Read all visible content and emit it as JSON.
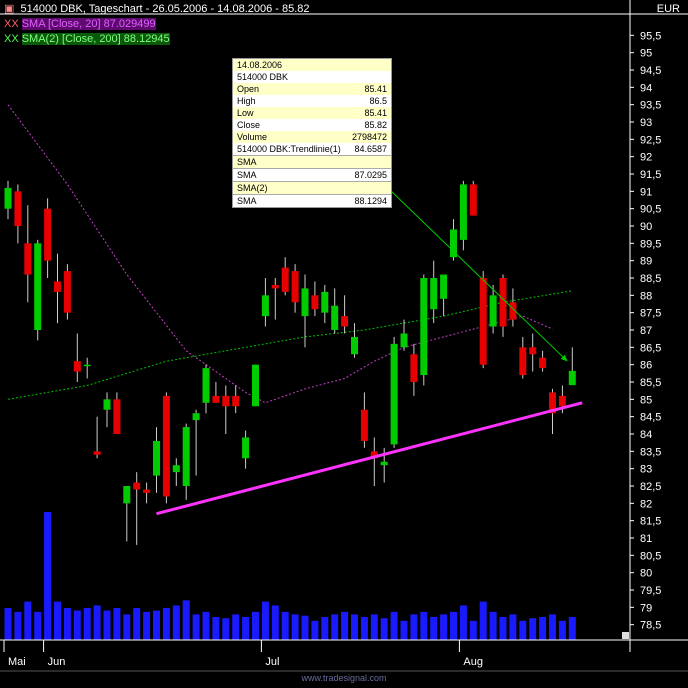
{
  "header": {
    "title": "514000  DBK, Tageschart - 26.05.2006 - 14.08.2006 - 85.82",
    "currency": "EUR",
    "legend": [
      {
        "marker": "XX",
        "text": "SMA [Close, 20] 87.029499",
        "color": "#e060ff"
      },
      {
        "marker": "XX",
        "text": "SMA(2) [Close, 200] 88.12945",
        "color": "#4fff4f"
      }
    ]
  },
  "infobox": {
    "date": "14.08.2006",
    "symbol": "514000  DBK",
    "rows": [
      {
        "label": "Open",
        "value": "85.41"
      },
      {
        "label": "High",
        "value": "86.5"
      },
      {
        "label": "Low",
        "value": "85.41"
      },
      {
        "label": "Close",
        "value": "85.82"
      },
      {
        "label": "Volume",
        "value": "2798472"
      },
      {
        "label": "514000  DBK:Trendlinie(1)",
        "value": "84.6587"
      },
      {
        "label": "SMA",
        "value": ""
      },
      {
        "label": "SMA",
        "value": "87.0295"
      },
      {
        "label": "SMA(2)",
        "value": ""
      },
      {
        "label": "SMA",
        "value": "88.1294"
      }
    ]
  },
  "footer": "www.tradesignal.com",
  "colors": {
    "up": "#00cc00",
    "down": "#e60000",
    "volume": "#1a1aff",
    "sma20": "#c040c0",
    "sma200": "#00c000",
    "trendline": "#ff33ff",
    "arrow": "#00cc00",
    "background": "#000000",
    "axis": "#ffffff"
  },
  "chart_data": {
    "type": "candlestick",
    "ylim": [
      78,
      96
    ],
    "yticks": [
      "78,5",
      "79",
      "79,5",
      "80",
      "80,5",
      "81",
      "81,5",
      "82",
      "82,5",
      "83",
      "83,5",
      "84",
      "84,5",
      "85",
      "85,5",
      "86",
      "86,5",
      "87",
      "87,5",
      "88",
      "88,5",
      "89",
      "89,5",
      "90",
      "90,5",
      "91",
      "91,5",
      "92",
      "92,5",
      "93",
      "93,5",
      "94",
      "94,5",
      "95",
      "95,5"
    ],
    "ytick_values": [
      78.5,
      79,
      79.5,
      80,
      80.5,
      81,
      81.5,
      82,
      82.5,
      83,
      83.5,
      84,
      84.5,
      85,
      85.5,
      86,
      86.5,
      87,
      87.5,
      88,
      88.5,
      89,
      89.5,
      90,
      90.5,
      91,
      91.5,
      92,
      92.5,
      93,
      93.5,
      94,
      94.5,
      95,
      95.5
    ],
    "xticks": [
      {
        "label": "Mai",
        "index": 0
      },
      {
        "label": "Jun",
        "index": 4
      },
      {
        "label": "Jul",
        "index": 26
      },
      {
        "label": "Aug",
        "index": 46
      }
    ],
    "candles": [
      {
        "o": 90.5,
        "h": 91.3,
        "l": 90.2,
        "c": 91.1
      },
      {
        "o": 91.0,
        "h": 91.2,
        "l": 89.5,
        "c": 90.0
      },
      {
        "o": 89.5,
        "h": 90.6,
        "l": 87.8,
        "c": 88.6
      },
      {
        "o": 87.0,
        "h": 89.6,
        "l": 86.7,
        "c": 89.5
      },
      {
        "o": 90.5,
        "h": 90.8,
        "l": 88.5,
        "c": 89.0
      },
      {
        "o": 88.4,
        "h": 89.2,
        "l": 87.2,
        "c": 88.1
      },
      {
        "o": 88.7,
        "h": 88.9,
        "l": 87.3,
        "c": 87.5
      },
      {
        "o": 86.1,
        "h": 86.9,
        "l": 85.5,
        "c": 85.8
      },
      {
        "o": 86.0,
        "h": 86.2,
        "l": 85.6,
        "c": 86.0
      },
      {
        "o": 83.5,
        "h": 84.5,
        "l": 83.3,
        "c": 83.4
      },
      {
        "o": 84.7,
        "h": 85.2,
        "l": 84.2,
        "c": 85.0
      },
      {
        "o": 85.0,
        "h": 85.2,
        "l": 84.0,
        "c": 84.0
      },
      {
        "o": 82.0,
        "h": 82.5,
        "l": 80.9,
        "c": 82.5
      },
      {
        "o": 82.6,
        "h": 82.9,
        "l": 80.8,
        "c": 82.4
      },
      {
        "o": 82.4,
        "h": 82.6,
        "l": 82.0,
        "c": 82.3
      },
      {
        "o": 82.8,
        "h": 84.2,
        "l": 82.3,
        "c": 83.8
      },
      {
        "o": 85.1,
        "h": 85.2,
        "l": 82.0,
        "c": 82.2
      },
      {
        "o": 82.9,
        "h": 83.3,
        "l": 82.5,
        "c": 83.1
      },
      {
        "o": 82.5,
        "h": 84.3,
        "l": 82.1,
        "c": 84.2
      },
      {
        "o": 84.4,
        "h": 84.7,
        "l": 82.8,
        "c": 84.6
      },
      {
        "o": 84.9,
        "h": 86.0,
        "l": 84.6,
        "c": 85.9
      },
      {
        "o": 85.1,
        "h": 85.5,
        "l": 84.9,
        "c": 84.9
      },
      {
        "o": 85.1,
        "h": 85.4,
        "l": 84.0,
        "c": 84.8
      },
      {
        "o": 85.1,
        "h": 85.4,
        "l": 84.6,
        "c": 84.8
      },
      {
        "o": 83.3,
        "h": 84.1,
        "l": 83.0,
        "c": 83.9
      },
      {
        "o": 84.8,
        "h": 86.0,
        "l": 84.8,
        "c": 86.0
      },
      {
        "o": 87.4,
        "h": 88.5,
        "l": 87.1,
        "c": 88.0
      },
      {
        "o": 88.3,
        "h": 88.5,
        "l": 87.3,
        "c": 88.2
      },
      {
        "o": 88.8,
        "h": 89.1,
        "l": 88.0,
        "c": 88.1
      },
      {
        "o": 88.7,
        "h": 88.9,
        "l": 87.5,
        "c": 87.8
      },
      {
        "o": 87.4,
        "h": 88.6,
        "l": 86.5,
        "c": 88.2
      },
      {
        "o": 88.0,
        "h": 88.4,
        "l": 87.4,
        "c": 87.6
      },
      {
        "o": 87.5,
        "h": 88.3,
        "l": 87.2,
        "c": 88.1
      },
      {
        "o": 87.0,
        "h": 88.2,
        "l": 86.9,
        "c": 87.7
      },
      {
        "o": 87.4,
        "h": 88.0,
        "l": 86.9,
        "c": 87.1
      },
      {
        "o": 86.3,
        "h": 87.2,
        "l": 86.2,
        "c": 86.8
      },
      {
        "o": 84.7,
        "h": 85.2,
        "l": 83.6,
        "c": 83.8
      },
      {
        "o": 83.5,
        "h": 83.9,
        "l": 82.5,
        "c": 83.3
      },
      {
        "o": 83.1,
        "h": 83.6,
        "l": 82.6,
        "c": 83.2
      },
      {
        "o": 83.7,
        "h": 86.8,
        "l": 83.6,
        "c": 86.6
      },
      {
        "o": 86.5,
        "h": 87.3,
        "l": 86.4,
        "c": 86.9
      },
      {
        "o": 86.3,
        "h": 86.6,
        "l": 85.1,
        "c": 85.5
      },
      {
        "o": 85.7,
        "h": 88.6,
        "l": 85.4,
        "c": 88.5
      },
      {
        "o": 87.6,
        "h": 89.0,
        "l": 87.2,
        "c": 88.5
      },
      {
        "o": 87.9,
        "h": 88.6,
        "l": 87.4,
        "c": 88.6
      },
      {
        "o": 89.1,
        "h": 90.2,
        "l": 89.0,
        "c": 89.9
      },
      {
        "o": 89.6,
        "h": 91.3,
        "l": 89.3,
        "c": 91.2
      },
      {
        "o": 91.2,
        "h": 91.3,
        "l": 90.3,
        "c": 90.3
      },
      {
        "o": 88.5,
        "h": 88.7,
        "l": 85.9,
        "c": 86.0
      },
      {
        "o": 87.1,
        "h": 88.3,
        "l": 86.9,
        "c": 88.0
      },
      {
        "o": 88.5,
        "h": 88.6,
        "l": 86.8,
        "c": 87.1
      },
      {
        "o": 87.8,
        "h": 88.2,
        "l": 87.1,
        "c": 87.3
      },
      {
        "o": 86.5,
        "h": 86.8,
        "l": 85.6,
        "c": 85.7
      },
      {
        "o": 86.5,
        "h": 86.9,
        "l": 85.8,
        "c": 86.3
      },
      {
        "o": 86.2,
        "h": 86.4,
        "l": 85.8,
        "c": 85.9
      },
      {
        "o": 85.2,
        "h": 85.3,
        "l": 84.0,
        "c": 84.6
      },
      {
        "o": 85.1,
        "h": 85.4,
        "l": 84.6,
        "c": 84.8
      },
      {
        "o": 85.41,
        "h": 86.5,
        "l": 85.41,
        "c": 85.82
      }
    ],
    "volume": [
      0.25,
      0.22,
      0.3,
      0.22,
      1.0,
      0.3,
      0.25,
      0.23,
      0.25,
      0.27,
      0.23,
      0.25,
      0.2,
      0.25,
      0.22,
      0.23,
      0.25,
      0.27,
      0.31,
      0.2,
      0.22,
      0.18,
      0.17,
      0.2,
      0.18,
      0.22,
      0.3,
      0.27,
      0.22,
      0.2,
      0.19,
      0.15,
      0.18,
      0.2,
      0.22,
      0.2,
      0.18,
      0.2,
      0.17,
      0.22,
      0.15,
      0.2,
      0.22,
      0.18,
      0.2,
      0.22,
      0.27,
      0.15,
      0.3,
      0.22,
      0.18,
      0.2,
      0.15,
      0.17,
      0.18,
      0.2,
      0.15,
      0.18
    ],
    "sma20_points": [
      [
        0,
        93.5
      ],
      [
        6,
        91.2
      ],
      [
        12,
        88.6
      ],
      [
        18,
        86.4
      ],
      [
        24,
        85.2
      ],
      [
        26,
        84.9
      ],
      [
        30,
        85.3
      ],
      [
        34,
        85.6
      ],
      [
        37,
        86.1
      ],
      [
        40,
        86.5
      ],
      [
        44,
        86.8
      ],
      [
        48,
        87.1
      ],
      [
        52,
        87.4
      ],
      [
        55,
        87.03
      ]
    ],
    "sma200_points": [
      [
        0,
        85.0
      ],
      [
        8,
        85.4
      ],
      [
        16,
        86.1
      ],
      [
        24,
        86.5
      ],
      [
        30,
        86.8
      ],
      [
        36,
        87.0
      ],
      [
        44,
        87.4
      ],
      [
        50,
        87.8
      ],
      [
        57,
        88.13
      ]
    ],
    "trendline": [
      [
        15,
        81.7
      ],
      [
        58,
        84.9
      ]
    ],
    "arrow": [
      [
        38,
        91.2
      ],
      [
        56.5,
        86.1
      ]
    ]
  }
}
